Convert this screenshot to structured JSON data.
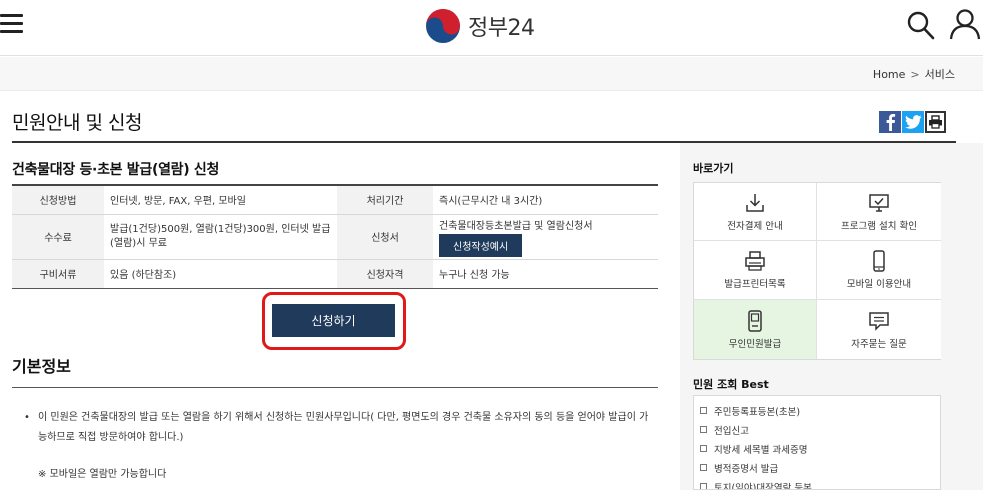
{
  "header": {
    "logo_text": "정부24"
  },
  "breadcrumb": {
    "home": "Home",
    "separator": ">",
    "current": "서비스"
  },
  "page": {
    "title": "민원안내 및 신청"
  },
  "service": {
    "title": "건축물대장 등·초본 발급(열람) 신청",
    "rows": [
      {
        "label1": "신청방법",
        "value1": "인터넷, 방문, FAX, 우편, 모바일",
        "label2": "처리기간",
        "value2": "즉시(근무시간 내 3시간)"
      },
      {
        "label1": "수수료",
        "value1": "발급(1건당)500원, 열람(1건당)300원, 인터넷 발급(열람)시 무료",
        "label2": "신청서",
        "value2": "건축물대장등초본발급 및 열람신청서",
        "value2_button": "신청작성예시"
      },
      {
        "label1": "구비서류",
        "value1": "있음 (하단참조)",
        "label2": "신청자격",
        "value2": "누구나 신청 가능"
      }
    ],
    "apply_button": "신청하기"
  },
  "basic_info": {
    "title": "기본정보",
    "bullet": "•",
    "text": "이 민원은 건축물대장의 발급 또는 열람을 하기 위해서 신청하는 민원사무입니다( 다만, 평면도의 경우 건축물 소유자의 동의 등을 얻어야 발급이 가능하므로 직접 방문하여야 합니다.)",
    "mobile_note": "※ 모바일은 열람만 가능합니다"
  },
  "sidebar": {
    "quick_title": "바로가기",
    "quick_items": [
      {
        "label": "전자결제 안내",
        "icon": "download-icon"
      },
      {
        "label": "프로그램 설치 확인",
        "icon": "monitor-check-icon"
      },
      {
        "label": "발급프린터목록",
        "icon": "printer-icon"
      },
      {
        "label": "모바일 이용안내",
        "icon": "mobile-icon"
      },
      {
        "label": "무인민원발급",
        "icon": "kiosk-icon"
      },
      {
        "label": "자주묻는 질문",
        "icon": "faq-chat-icon"
      }
    ],
    "best_title": "민원 조회 Best",
    "best_items": [
      "주민등록표등본(초본)",
      "전입신고",
      "지방세 세목별 과세증명",
      "병적증명서 발급",
      "토지(임야)대장열람 등본"
    ]
  },
  "colors": {
    "navy_button": "#1f3a5a",
    "highlight_border": "#e01818",
    "kiosk_highlight": "#e6f4e2",
    "facebook": "#3b5998",
    "twitter": "#1da1f2"
  }
}
